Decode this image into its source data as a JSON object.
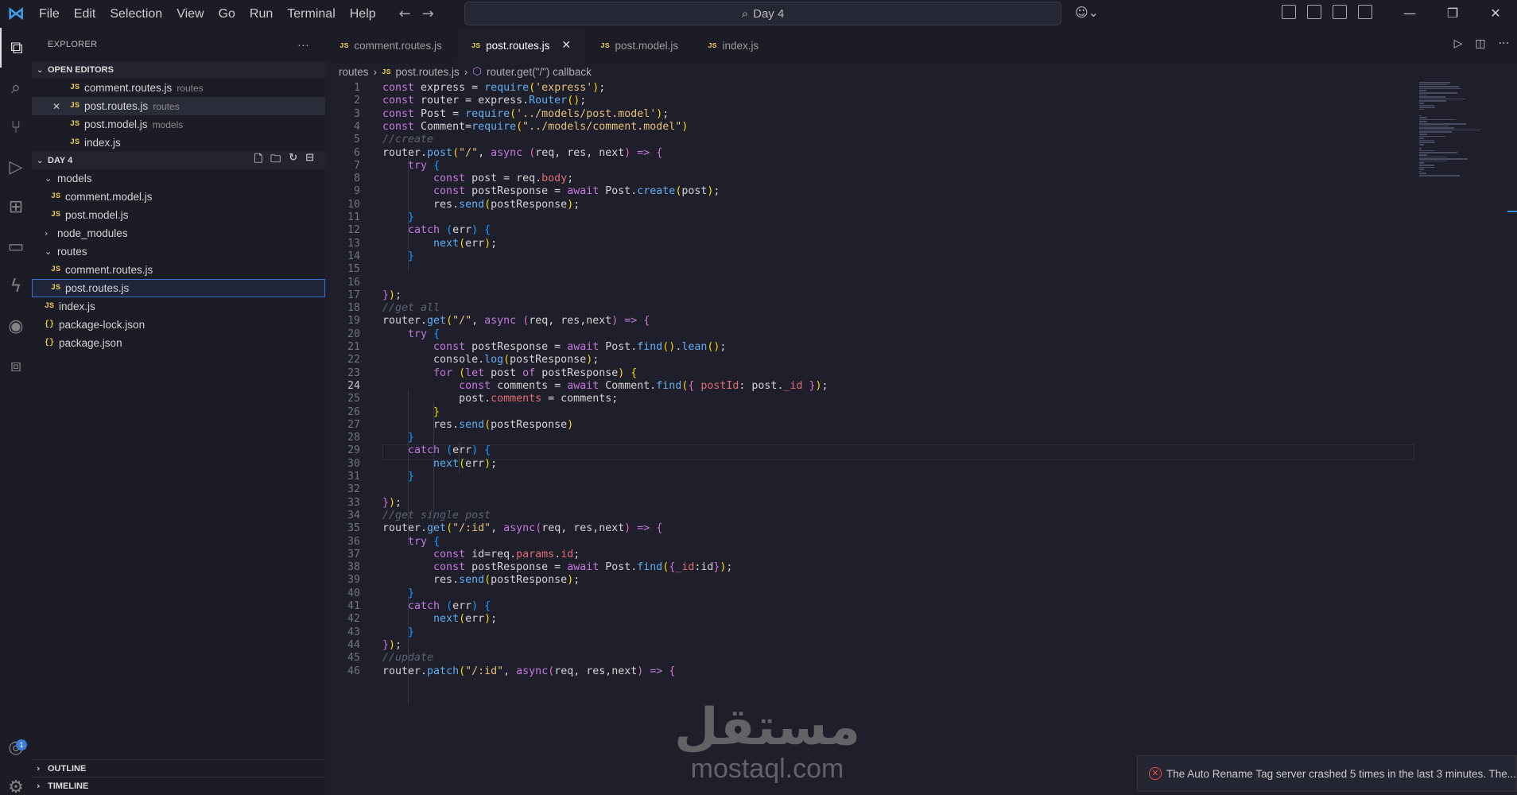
{
  "menu": {
    "logo": "⋈",
    "items": [
      "File",
      "Edit",
      "Selection",
      "View",
      "Go",
      "Run",
      "Terminal",
      "Help"
    ]
  },
  "command_center": {
    "text": "Day 4"
  },
  "explorer": {
    "header": "EXPLORER",
    "more": "···",
    "open_editors_label": "OPEN EDITORS",
    "open_editors": [
      {
        "name": "comment.routes.js",
        "hint": "routes",
        "close": ""
      },
      {
        "name": "post.routes.js",
        "hint": "routes",
        "close": "✕"
      },
      {
        "name": "post.model.js",
        "hint": "models",
        "close": ""
      },
      {
        "name": "index.js",
        "hint": "",
        "close": ""
      }
    ],
    "folder_label": "DAY 4",
    "tree": [
      {
        "name": "models",
        "icon": "⌄"
      },
      {
        "name": "comment.model.js",
        "icon": "JS"
      },
      {
        "name": "post.model.js",
        "icon": "JS"
      },
      {
        "name": "node_modules",
        "icon": "›"
      },
      {
        "name": "routes",
        "icon": "⌄"
      },
      {
        "name": "comment.routes.js",
        "icon": "JS"
      },
      {
        "name": "post.routes.js",
        "icon": "JS"
      },
      {
        "name": "index.js",
        "icon": "JS"
      },
      {
        "name": "package-lock.json",
        "icon": "{}"
      },
      {
        "name": "package.json",
        "icon": "{}"
      }
    ],
    "outline_label": "OUTLINE",
    "timeline_label": "TIMELINE"
  },
  "tabs": [
    {
      "label": "comment.routes.js",
      "icon": "JS",
      "close": ""
    },
    {
      "label": "post.routes.js",
      "icon": "JS",
      "close": "✕"
    },
    {
      "label": "post.model.js",
      "icon": "JS",
      "close": ""
    },
    {
      "label": "index.js",
      "icon": "JS",
      "close": ""
    }
  ],
  "breadcrumb": {
    "folder": "routes",
    "sep": "›",
    "file_icon": "JS",
    "file": "post.routes.js",
    "symbol": "router.get(\"/\") callback"
  },
  "editor": {
    "current_line": "24",
    "line_numbers": [
      "1",
      "2",
      "3",
      "4",
      "5",
      "6",
      "7",
      "8",
      "9",
      "10",
      "11",
      "12",
      "13",
      "14",
      "15",
      "16",
      "17",
      "18",
      "19",
      "20",
      "21",
      "22",
      "23",
      "24",
      "25",
      "26",
      "27",
      "28",
      "29",
      "30",
      "31",
      "32",
      "33",
      "34",
      "35",
      "36",
      "37",
      "38",
      "39",
      "40",
      "41",
      "42",
      "43",
      "44",
      "45",
      "46"
    ]
  },
  "notification": {
    "icon": "✕",
    "text": "The Auto Rename Tag server crashed 5 times in the last 3 minutes. The..."
  },
  "account_badge": "1",
  "watermark": {
    "arabic": "مستقل",
    "latin": "mostaql.com"
  },
  "colors": {
    "accent": "#3b6fd6",
    "keyword": "#c678dd",
    "function": "#61afef",
    "string": "#e5c07b",
    "comment": "#5c6370",
    "error": "#f14c4c"
  }
}
